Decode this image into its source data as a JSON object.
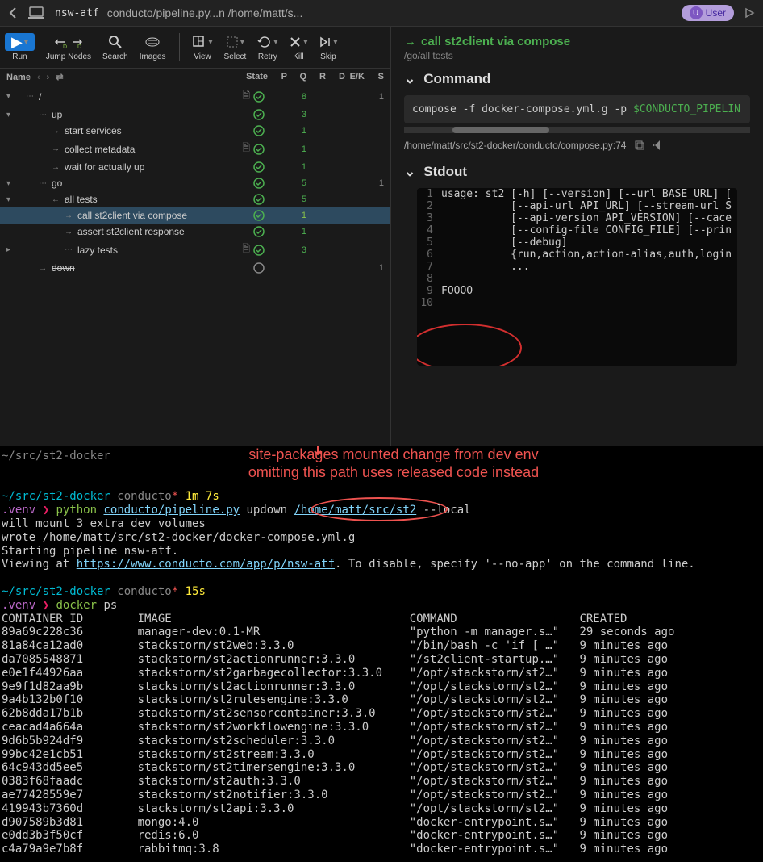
{
  "topbar": {
    "pipeline_id": "nsw-atf",
    "path": "conducto/pipeline.py...n /home/matt/s...",
    "user_label": "User"
  },
  "toolbar": {
    "run": "Run",
    "jump": "Jump Nodes",
    "search": "Search",
    "images": "Images",
    "view": "View",
    "select": "Select",
    "retry": "Retry",
    "kill": "Kill",
    "skip": "Skip"
  },
  "tree_header": {
    "name": "Name",
    "state": "State",
    "p": "P",
    "q": "Q",
    "r": "R",
    "d": "D",
    "ek": "E/K",
    "s": "S"
  },
  "tree": [
    {
      "expand": "▾",
      "indent": 0,
      "icon": "⋯",
      "label": "/",
      "doc": true,
      "state": "done",
      "q": "8",
      "s": "1"
    },
    {
      "expand": "▾",
      "indent": 1,
      "icon": "⋯",
      "label": "up",
      "state": "done",
      "q": "3"
    },
    {
      "expand": "",
      "indent": 2,
      "icon": "→",
      "label": "start services",
      "state": "done",
      "q": "1"
    },
    {
      "expand": "",
      "indent": 2,
      "icon": "→",
      "label": "collect metadata",
      "doc": true,
      "state": "done",
      "q": "1"
    },
    {
      "expand": "",
      "indent": 2,
      "icon": "→",
      "label": "wait for actually up",
      "state": "done",
      "q": "1"
    },
    {
      "expand": "▾",
      "indent": 1,
      "icon": "⋯",
      "label": "go",
      "state": "done",
      "q": "5",
      "s": "1"
    },
    {
      "expand": "▾",
      "indent": 2,
      "icon": "←",
      "label": "all tests",
      "state": "done",
      "q": "5"
    },
    {
      "expand": "",
      "indent": 3,
      "icon": "→",
      "label": "call st2client via compose",
      "state": "done",
      "q": "1",
      "selected": true
    },
    {
      "expand": "",
      "indent": 3,
      "icon": "→",
      "label": "assert st2client response",
      "state": "done",
      "q": "1"
    },
    {
      "expand": "▸",
      "indent": 3,
      "icon": "⋯",
      "label": "lazy tests",
      "doc": true,
      "state": "done",
      "q": "3"
    },
    {
      "expand": "",
      "indent": 1,
      "icon": "→",
      "label": "down",
      "state": "pending",
      "strike": true,
      "s": "1"
    }
  ],
  "right": {
    "title": "call st2client via compose",
    "path": "/go/all tests",
    "command_label": "Command",
    "command_text": "compose -f docker-compose.yml.g -p ",
    "command_env": "$CONDUCTO_PIPELIN",
    "file_ref": "/home/matt/src/st2-docker/conducto/compose.py:74",
    "stdout_label": "Stdout",
    "stdout": [
      "usage: st2 [-h] [--version] [--url BASE_URL] [",
      "           [--api-url API_URL] [--stream-url S",
      "           [--api-version API_VERSION] [--cace",
      "           [--config-file CONFIG_FILE] [--prin",
      "           [--debug]",
      "           {run,action,action-alias,auth,login",
      "           ...",
      "",
      "FOOOO",
      ""
    ]
  },
  "terminal": {
    "cwd_short": "~/src/st2-docker",
    "annotation1": "site-packages mounted change from dev env",
    "annotation2": "omitting this path uses released code instead",
    "prompt1_path": "~/src/st2-docker",
    "prompt1_branch": "conducto",
    "prompt1_time": "1m 7s",
    "venv": ".venv",
    "cmd1_prog": "python",
    "cmd1_arg1": "conducto/pipeline.py",
    "cmd1_arg2": " updown ",
    "cmd1_arg3": "/home/matt/src/st2",
    "cmd1_arg4": " --local",
    "out1_l1": "will mount 3 extra dev volumes",
    "out1_l2": "wrote /home/matt/src/st2-docker/docker-compose.yml.g",
    "out1_l3": "Starting pipeline nsw-atf.",
    "out1_l4a": "Viewing at ",
    "out1_l4b": "https://www.conducto.com/app/p/nsw-atf",
    "out1_l4c": ". To disable, specify '--no-app' on the command line.",
    "prompt2_time": "15s",
    "cmd2_prog": "docker",
    "cmd2_args": " ps",
    "ps_header": "CONTAINER ID        IMAGE                                   COMMAND                  CREATED",
    "ps_rows": [
      {
        "id": "89a69c228c36",
        "image": "manager-dev:0.1-MR",
        "cmd": "\"python -m manager.s…\"",
        "created": "29 seconds ago"
      },
      {
        "id": "81a84ca12ad0",
        "image": "stackstorm/st2web:3.3.0",
        "cmd": "\"/bin/bash -c 'if [ …\"",
        "created": "9 minutes ago"
      },
      {
        "id": "da7085548871",
        "image": "stackstorm/st2actionrunner:3.3.0",
        "cmd": "\"/st2client-startup.…\"",
        "created": "9 minutes ago"
      },
      {
        "id": "e0e1f44926aa",
        "image": "stackstorm/st2garbagecollector:3.3.0",
        "cmd": "\"/opt/stackstorm/st2…\"",
        "created": "9 minutes ago"
      },
      {
        "id": "9e9f1d82aa9b",
        "image": "stackstorm/st2actionrunner:3.3.0",
        "cmd": "\"/opt/stackstorm/st2…\"",
        "created": "9 minutes ago"
      },
      {
        "id": "9a4b132b0f10",
        "image": "stackstorm/st2rulesengine:3.3.0",
        "cmd": "\"/opt/stackstorm/st2…\"",
        "created": "9 minutes ago"
      },
      {
        "id": "62b8dda17b1b",
        "image": "stackstorm/st2sensorcontainer:3.3.0",
        "cmd": "\"/opt/stackstorm/st2…\"",
        "created": "9 minutes ago"
      },
      {
        "id": "ceacad4a664a",
        "image": "stackstorm/st2workflowengine:3.3.0",
        "cmd": "\"/opt/stackstorm/st2…\"",
        "created": "9 minutes ago"
      },
      {
        "id": "9d6b5b924df9",
        "image": "stackstorm/st2scheduler:3.3.0",
        "cmd": "\"/opt/stackstorm/st2…\"",
        "created": "9 minutes ago"
      },
      {
        "id": "99bc42e1cb51",
        "image": "stackstorm/st2stream:3.3.0",
        "cmd": "\"/opt/stackstorm/st2…\"",
        "created": "9 minutes ago"
      },
      {
        "id": "64c943dd5ee5",
        "image": "stackstorm/st2timersengine:3.3.0",
        "cmd": "\"/opt/stackstorm/st2…\"",
        "created": "9 minutes ago"
      },
      {
        "id": "0383f68faadc",
        "image": "stackstorm/st2auth:3.3.0",
        "cmd": "\"/opt/stackstorm/st2…\"",
        "created": "9 minutes ago"
      },
      {
        "id": "ae77428559e7",
        "image": "stackstorm/st2notifier:3.3.0",
        "cmd": "\"/opt/stackstorm/st2…\"",
        "created": "9 minutes ago"
      },
      {
        "id": "419943b7360d",
        "image": "stackstorm/st2api:3.3.0",
        "cmd": "\"/opt/stackstorm/st2…\"",
        "created": "9 minutes ago"
      },
      {
        "id": "d907589b3d81",
        "image": "mongo:4.0",
        "cmd": "\"docker-entrypoint.s…\"",
        "created": "9 minutes ago"
      },
      {
        "id": "e0dd3b3f50cf",
        "image": "redis:6.0",
        "cmd": "\"docker-entrypoint.s…\"",
        "created": "9 minutes ago"
      },
      {
        "id": "c4a79a9e7b8f",
        "image": "rabbitmq:3.8",
        "cmd": "\"docker-entrypoint.s…\"",
        "created": "9 minutes ago"
      }
    ]
  }
}
